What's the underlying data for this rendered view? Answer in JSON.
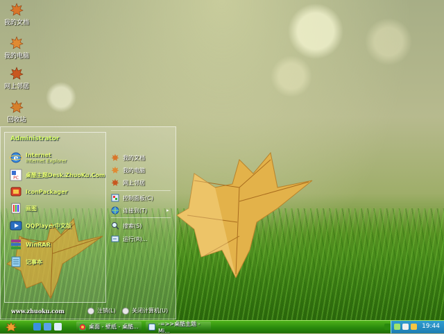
{
  "desktop": {
    "icons": [
      {
        "label": "我的文档"
      },
      {
        "label": "我的电脑"
      },
      {
        "label": "网上邻居"
      },
      {
        "label": "回收站"
      }
    ]
  },
  "start_menu": {
    "user": "Administrator",
    "programs": [
      {
        "title": "Internet",
        "subtitle": "Internet Explorer",
        "icon": "ie-icon"
      },
      {
        "title": "桌酷主题Desk.ZhuoKu.Com",
        "icon": "theme-icon"
      },
      {
        "title": "IconPackager",
        "icon": "iconpackager-icon"
      },
      {
        "title": "画图",
        "icon": "paint-icon"
      },
      {
        "title": "QQPlayer中文版",
        "icon": "player-icon"
      },
      {
        "title": "WinRAR",
        "icon": "winrar-icon"
      },
      {
        "title": "记事本",
        "icon": "notepad-icon"
      }
    ],
    "places": [
      {
        "label": "我的文档"
      },
      {
        "label": "我的电脑"
      },
      {
        "label": "网上邻居"
      },
      {
        "label": "控制面板(C)"
      },
      {
        "label": "连接到(T)"
      },
      {
        "label": "搜索(S)"
      },
      {
        "label": "运行(R)..."
      }
    ],
    "site": "www.zhuoku.com",
    "logoff": "注销(L)",
    "shutdown": "关闭计算机(U)"
  },
  "taskbar": {
    "items": [
      {
        "label": "桌面 - 壁纸 - 桌酷..."
      },
      {
        "label": "-=>>桌酷主题 - Mi..."
      }
    ],
    "clock": "19:44"
  },
  "colors": {
    "taskbar": "#2a8a0d",
    "tray": "#1e7db2",
    "menu_text_accent": "#eaff70"
  }
}
